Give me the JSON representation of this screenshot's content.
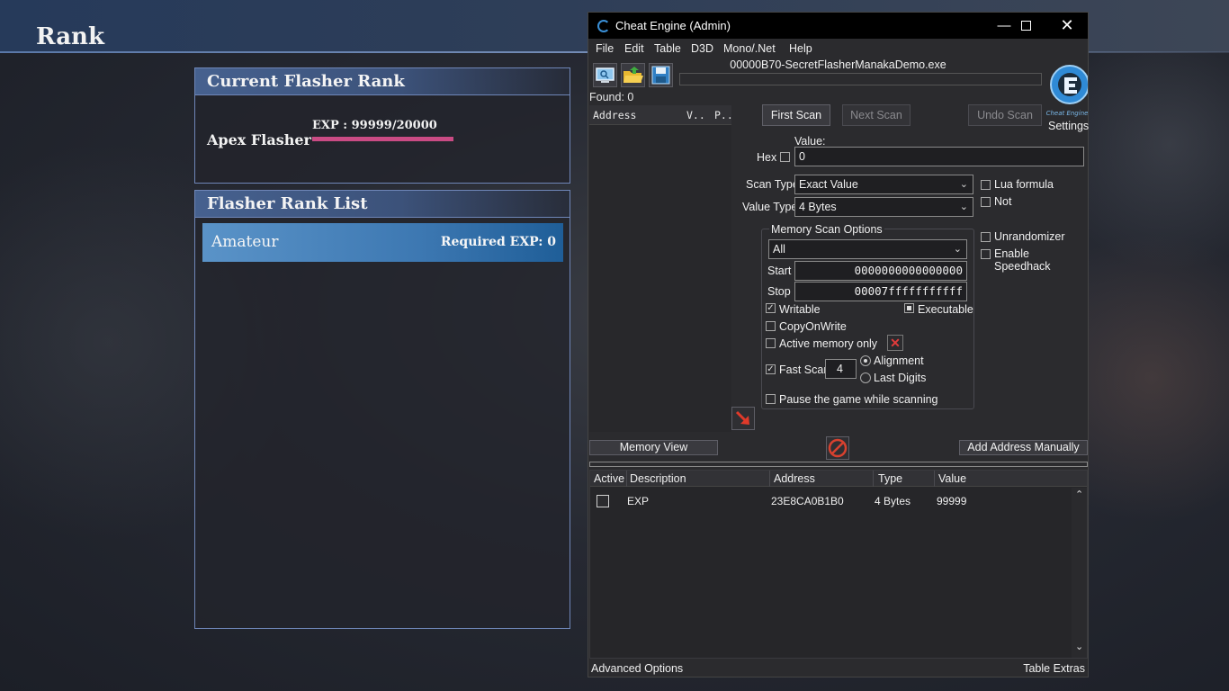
{
  "game": {
    "page_title": "Rank",
    "current_rank_panel": {
      "title": "Current Flasher Rank",
      "rank_name": "Apex Flasher",
      "exp_text": "EXP : 99999/20000",
      "exp_progress_fraction": 1.0
    },
    "rank_list_panel": {
      "title": "Flasher Rank List",
      "items": [
        {
          "name": "Amateur",
          "required": "Required EXP: 0"
        }
      ]
    }
  },
  "ce": {
    "window_title": "Cheat Engine (Admin)",
    "menu": [
      "File",
      "Edit",
      "Table",
      "D3D",
      "Mono/.Net",
      "Help"
    ],
    "process_name": "00000B70-SecretFlasherManakaDemo.exe",
    "found_label": "Found: 0",
    "settings_label": "Settings",
    "logo_text": "Cheat Engine",
    "address_list_columns": [
      "Address",
      "V..",
      "P.."
    ],
    "buttons": {
      "first_scan": "First Scan",
      "next_scan": "Next Scan",
      "undo_scan": "Undo Scan",
      "memory_view": "Memory View",
      "add_address": "Add Address Manually"
    },
    "value_label": "Value:",
    "hex_label": "Hex",
    "value_input": "0",
    "scan_type_label": "Scan Type",
    "scan_type_value": "Exact Value",
    "value_type_label": "Value Type",
    "value_type_value": "4 Bytes",
    "lua_formula_label": "Lua formula",
    "not_label": "Not",
    "unrandomizer_label": "Unrandomizer",
    "speedhack_label": "Enable Speedhack",
    "memory_scan": {
      "title": "Memory Scan Options",
      "region_value": "All",
      "start_label": "Start",
      "start_value": "0000000000000000",
      "stop_label": "Stop",
      "stop_value": "00007fffffffffff",
      "writable_label": "Writable",
      "executable_label": "Executable",
      "copyonwrite_label": "CopyOnWrite",
      "active_memory_label": "Active memory only",
      "fast_scan_label": "Fast Scan",
      "fast_scan_value": "4",
      "alignment_label": "Alignment",
      "last_digits_label": "Last Digits",
      "pause_label": "Pause the game while scanning"
    },
    "cheat_table": {
      "columns": [
        "Active",
        "Description",
        "Address",
        "Type",
        "Value"
      ],
      "rows": [
        {
          "description": "EXP",
          "address": "23E8CA0B1B0",
          "type": "4 Bytes",
          "value": "99999"
        }
      ]
    },
    "footer_left": "Advanced Options",
    "footer_right": "Table Extras"
  },
  "colors": {
    "exp_bar": "#c94b84",
    "rank_row": "#3d78b2",
    "panel_border": "#6f86b8",
    "ce_background": "#2b2b2e"
  },
  "icons": [
    "cheat-engine-app-icon",
    "minimize-icon",
    "maximize-icon",
    "close-icon",
    "open-process-icon",
    "open-folder-icon",
    "save-icon",
    "red-x-icon",
    "red-arrow-icon",
    "stop-icon",
    "scroll-up-icon",
    "scroll-down-icon",
    "dropdown-caret-icon"
  ]
}
